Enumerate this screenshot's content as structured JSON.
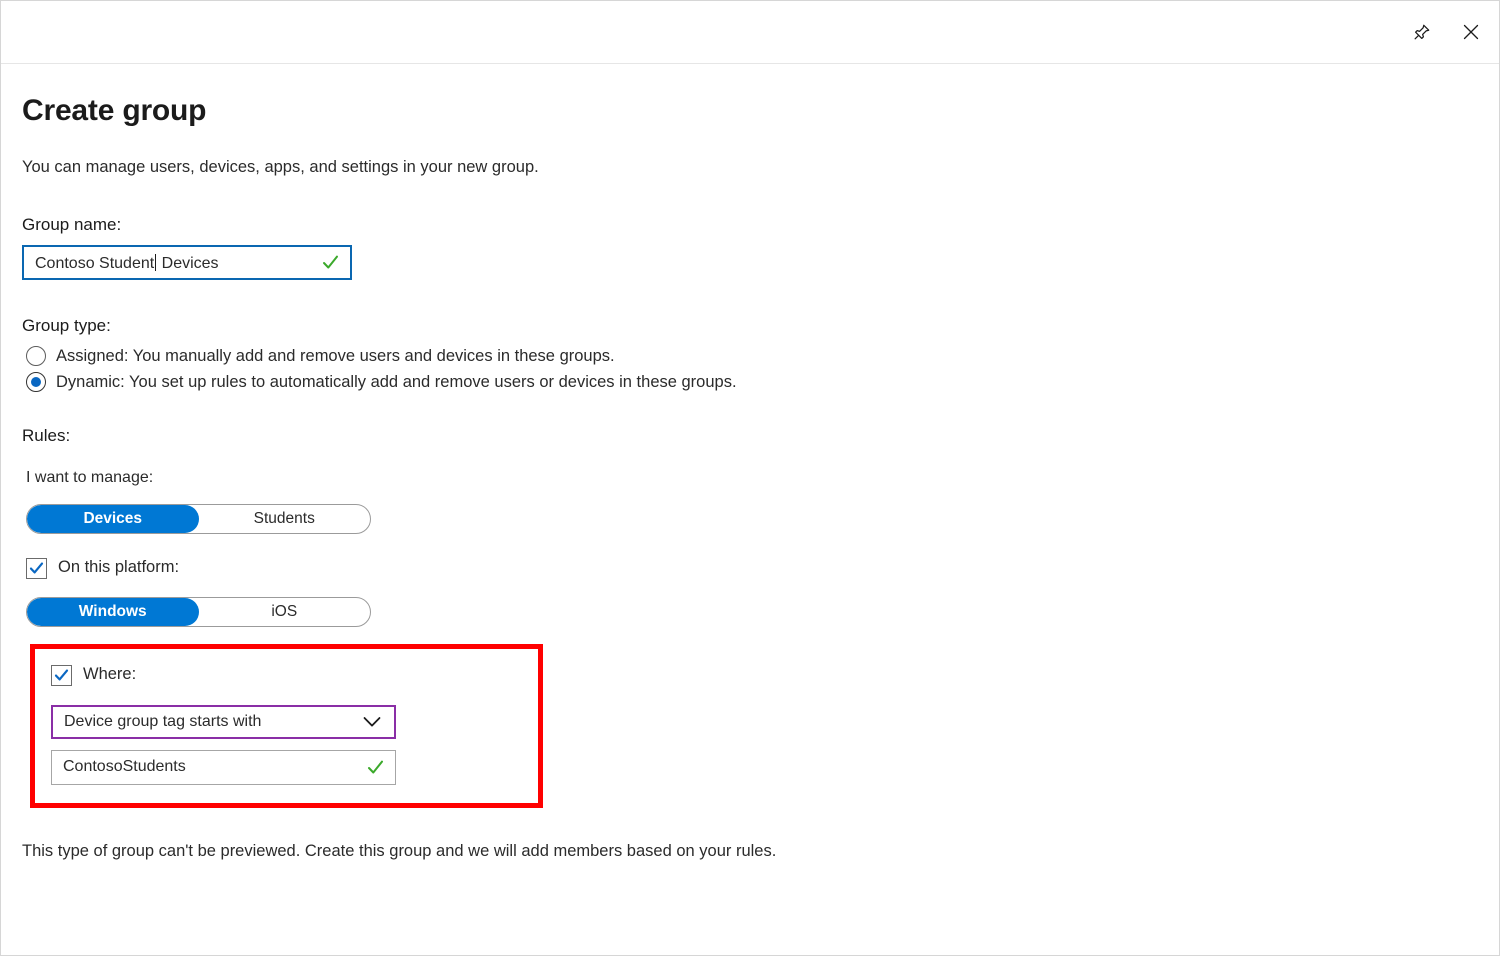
{
  "window": {
    "titlebar": {
      "pin_icon": "pin-icon",
      "close_icon": "close-icon"
    }
  },
  "page": {
    "title": "Create group",
    "subtitle": "You can manage users, devices, apps, and settings in your new group."
  },
  "group_name": {
    "label": "Group name:",
    "value_before_caret": "Contoso Student",
    "value_after_caret": " Devices",
    "full_value": "Contoso Student Devices",
    "valid_icon": "green-check-icon",
    "valid_color": "#3ba92b"
  },
  "group_type": {
    "label": "Group type:",
    "options": [
      {
        "id": "assigned",
        "label": "Assigned: You manually add and remove users and devices in these groups.",
        "selected": false
      },
      {
        "id": "dynamic",
        "label": "Dynamic: You set up rules to automatically add and remove users or devices in these groups.",
        "selected": true
      }
    ],
    "selected_color": "#0a67c2"
  },
  "rules": {
    "label": "Rules:",
    "manage": {
      "label": "I want to manage:",
      "options": [
        "Devices",
        "Students"
      ],
      "selected": "Devices"
    },
    "platform": {
      "checkbox_label": "On this platform:",
      "checked": true,
      "options": [
        "Windows",
        "iOS"
      ],
      "selected": "Windows"
    },
    "where": {
      "checkbox_label": "Where:",
      "checked": true,
      "condition": {
        "selected": "Device group tag starts with",
        "chevron_icon": "chevron-down-icon",
        "border_color": "#8a2ea6"
      },
      "value_field": {
        "value": "ContosoStudents",
        "valid_icon": "green-check-icon"
      },
      "highlight_color": "#ff0000"
    }
  },
  "footer": {
    "note": "This type of group can't be previewed. Create this group and we will add members based on your rules."
  },
  "theme": {
    "accent_blue": "#0078d4",
    "focus_blue": "#0a67b1",
    "purple": "#8a2ea6",
    "success_green": "#3ba92b",
    "highlight_red": "#ff0000"
  }
}
